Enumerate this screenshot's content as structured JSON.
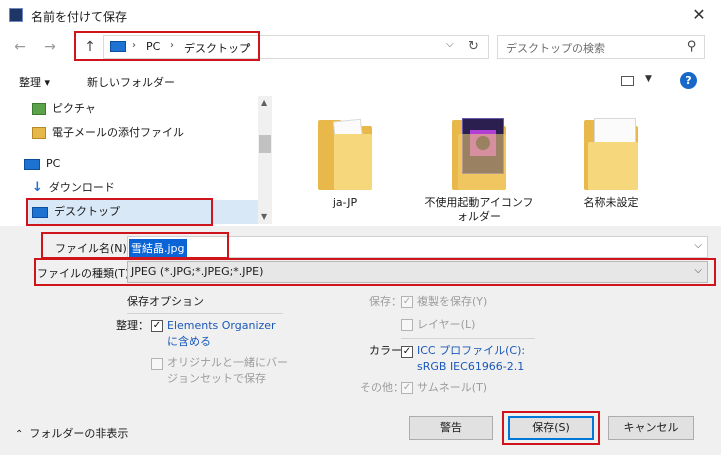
{
  "window": {
    "title": "名前を付けて保存",
    "close_glyph": "✕"
  },
  "nav": {
    "back_glyph": "←",
    "forward_glyph": "→",
    "up_glyph": "↑",
    "breadcrumb": [
      "PC",
      "デスクトップ"
    ],
    "crumb_sep": "›",
    "search_placeholder": "デスクトップの検索"
  },
  "toolbar": {
    "organize": "整理 ▾",
    "new_folder": "新しいフォルダー",
    "help": "?"
  },
  "navpane": {
    "items": [
      {
        "label": "ピクチャ",
        "icon": "pictures-icon"
      },
      {
        "label": "電子メールの添付ファイル",
        "icon": "email-attachments-icon"
      },
      {
        "label": "PC",
        "icon": "pc-icon"
      },
      {
        "label": "ダウンロード",
        "icon": "download-icon"
      },
      {
        "label": "デスクトップ",
        "icon": "desktop-icon"
      }
    ]
  },
  "files": [
    {
      "label": "ja-JP",
      "icon": "folder-icon"
    },
    {
      "label": "不使用起動アイコンフォルダー",
      "icon": "folder-icon"
    },
    {
      "label": "名称未設定",
      "icon": "folder-icon"
    }
  ],
  "form": {
    "filename_label": "ファイル名(N):",
    "filename_value": "雪結晶.jpg",
    "filetype_label": "ファイルの種類(T):",
    "filetype_value": "JPEG (*.JPG;*.JPEG;*.JPE)"
  },
  "options": {
    "header": "保存オプション",
    "organize_label": "整理：",
    "organize_cb": "Elements Organizer に含める",
    "version_cb": "オリジナルと一緒にバージョンセットで保存",
    "save_label": "保存：",
    "save_copy_cb": "複製を保存(Y)",
    "layers_cb": "レイヤー(L)",
    "color_label": "カラー：",
    "icc_cb": "ICC プロファイル(C): sRGB IEC61966-2.1",
    "other_label": "その他：",
    "thumbnail_cb": "サムネール(T)"
  },
  "footer": {
    "hide_folders": "フォルダーの非表示",
    "warning_btn": "警告",
    "save_btn": "保存(S)",
    "cancel_btn": "キャンセル"
  },
  "colors": {
    "accent": "#0078d7",
    "highlight": "#d0141c",
    "selection": "#0a64d6"
  }
}
